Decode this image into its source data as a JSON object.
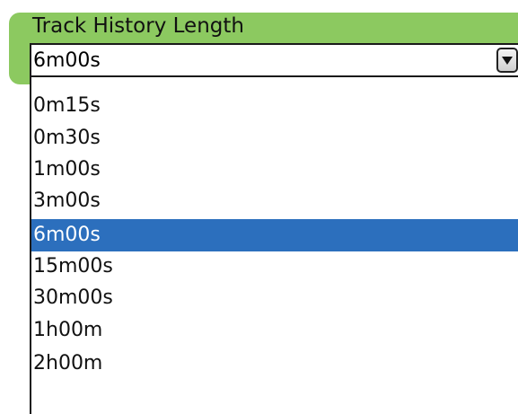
{
  "panel": {
    "title": "Track History Length",
    "accent_color": "#8cc960"
  },
  "combo": {
    "value": "6m00s",
    "arrow_icon": "chevron-down-icon"
  },
  "dropdown": {
    "options": [
      "0m15s",
      "0m30s",
      "1m00s",
      "3m00s",
      "6m00s",
      "15m00s",
      "30m00s",
      "1h00m",
      "2h00m"
    ],
    "selected_index": 4,
    "selection_color": "#2c6fbd"
  }
}
